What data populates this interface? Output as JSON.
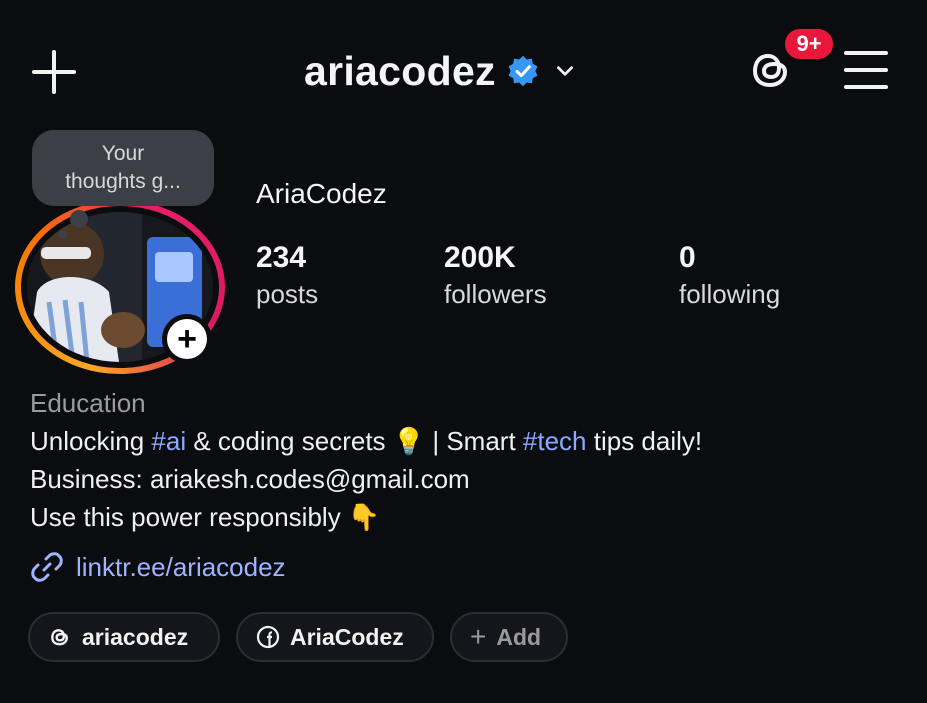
{
  "header": {
    "username": "ariacodez",
    "notification_badge": "9+"
  },
  "note": {
    "text_line1": "Your",
    "text_line2": "thoughts g..."
  },
  "profile": {
    "display_name": "AriaCodez",
    "stats": {
      "posts": {
        "value": "234",
        "label": "posts"
      },
      "followers": {
        "value": "200K",
        "label": "followers"
      },
      "following": {
        "value": "0",
        "label": "following"
      }
    },
    "category": "Education",
    "bio": {
      "line1_pre": "Unlocking ",
      "line1_tag1": "#ai",
      "line1_mid": " & coding secrets 💡 | Smart ",
      "line1_tag2": "#tech",
      "line1_post": " tips daily!",
      "line2": "Business: ariakesh.codes@gmail.com",
      "line3": "Use this power responsibly 👇"
    },
    "link": "linktr.ee/ariacodez"
  },
  "chips": {
    "threads": "ariacodez",
    "facebook": "AriaCodez",
    "add": "Add"
  },
  "colors": {
    "background": "#0b0c10",
    "badge": "#e9183a",
    "verified": "#3897f0",
    "hashtag": "#8aa9ff",
    "link": "#9fb3ff"
  },
  "icons": [
    "plus-icon",
    "verified-badge-icon",
    "chevron-down-icon",
    "threads-icon",
    "menu-icon",
    "add-story-icon",
    "link-icon",
    "facebook-icon"
  ]
}
